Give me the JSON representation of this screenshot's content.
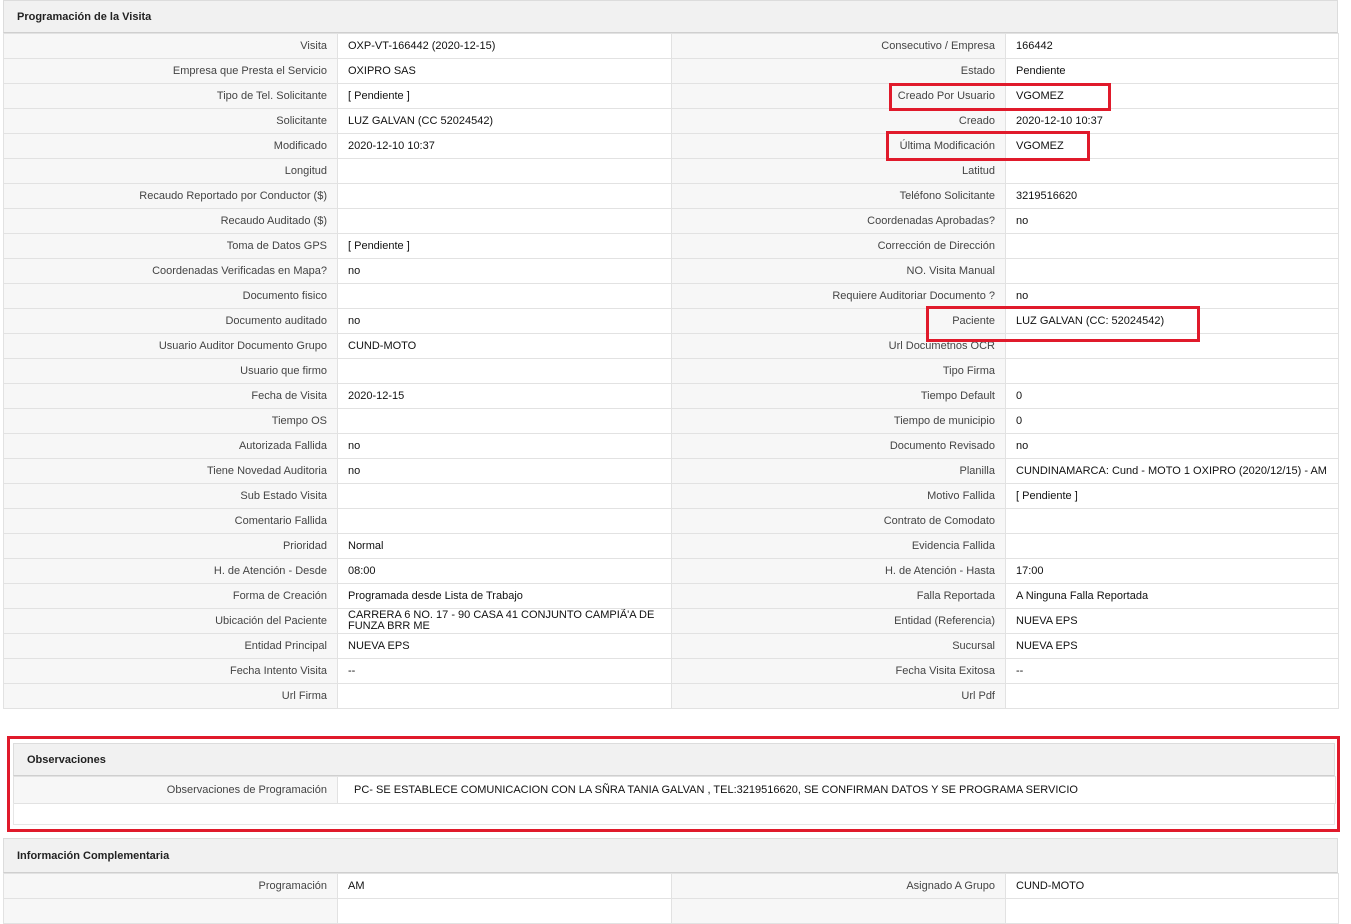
{
  "sections": {
    "programacion_title": "Programación de la Visita",
    "observaciones_title": "Observaciones",
    "complementaria_title": "Información Complementaria"
  },
  "programacion_rows": [
    [
      {
        "label": "Visita",
        "value": "OXP-VT-166442 (2020-12-15)"
      },
      {
        "label": "Consecutivo / Empresa",
        "value": "166442"
      }
    ],
    [
      {
        "label": "Empresa que Presta el Servicio",
        "value": "OXIPRO SAS"
      },
      {
        "label": "Estado",
        "value": "Pendiente"
      }
    ],
    [
      {
        "label": "Tipo de Tel. Solicitante",
        "value": "[ Pendiente ]"
      },
      {
        "label": "Creado Por Usuario",
        "value": "VGOMEZ"
      }
    ],
    [
      {
        "label": "Solicitante",
        "value": "LUZ GALVAN (CC 52024542)"
      },
      {
        "label": "Creado",
        "value": "2020-12-10 10:37"
      }
    ],
    [
      {
        "label": "Modificado",
        "value": "2020-12-10 10:37"
      },
      {
        "label": "Última Modificación",
        "value": "VGOMEZ"
      }
    ],
    [
      {
        "label": "Longitud",
        "value": ""
      },
      {
        "label": "Latitud",
        "value": ""
      }
    ],
    [
      {
        "label": "Recaudo Reportado por Conductor ($)",
        "value": ""
      },
      {
        "label": "Teléfono Solicitante",
        "value": "3219516620"
      }
    ],
    [
      {
        "label": "Recaudo Auditado ($)",
        "value": ""
      },
      {
        "label": "Coordenadas Aprobadas?",
        "value": "no"
      }
    ],
    [
      {
        "label": "Toma de Datos GPS",
        "value": "[ Pendiente ]"
      },
      {
        "label": "Corrección de Dirección",
        "value": ""
      }
    ],
    [
      {
        "label": "Coordenadas Verificadas en Mapa?",
        "value": "no"
      },
      {
        "label": "NO. Visita Manual",
        "value": ""
      }
    ],
    [
      {
        "label": "Documento fisico",
        "value": ""
      },
      {
        "label": "Requiere Auditoriar Documento ?",
        "value": "no"
      }
    ],
    [
      {
        "label": "Documento auditado",
        "value": "no"
      },
      {
        "label": "Paciente",
        "value": "LUZ GALVAN (CC: 52024542)"
      }
    ],
    [
      {
        "label": "Usuario Auditor Documento Grupo",
        "value": "CUND-MOTO"
      },
      {
        "label": "Url Documetnos OCR",
        "value": ""
      }
    ],
    [
      {
        "label": "Usuario que firmo",
        "value": ""
      },
      {
        "label": "Tipo Firma",
        "value": ""
      }
    ],
    [
      {
        "label": "Fecha de Visita",
        "value": "2020-12-15"
      },
      {
        "label": "Tiempo Default",
        "value": "0"
      }
    ],
    [
      {
        "label": "Tiempo OS",
        "value": ""
      },
      {
        "label": "Tiempo de municipio",
        "value": "0"
      }
    ],
    [
      {
        "label": "Autorizada Fallida",
        "value": "no"
      },
      {
        "label": "Documento Revisado",
        "value": "no"
      }
    ],
    [
      {
        "label": "Tiene Novedad Auditoria",
        "value": "no"
      },
      {
        "label": "Planilla",
        "value": "CUNDINAMARCA: Cund - MOTO 1 OXIPRO (2020/12/15) - AM"
      }
    ],
    [
      {
        "label": "Sub Estado Visita",
        "value": ""
      },
      {
        "label": "Motivo Fallida",
        "value": "[ Pendiente ]"
      }
    ],
    [
      {
        "label": "Comentario Fallida",
        "value": ""
      },
      {
        "label": "Contrato de Comodato",
        "value": ""
      }
    ],
    [
      {
        "label": "Prioridad",
        "value": "Normal"
      },
      {
        "label": "Evidencia Fallida",
        "value": ""
      }
    ],
    [
      {
        "label": "H. de Atención - Desde",
        "value": "08:00"
      },
      {
        "label": "H. de Atención - Hasta",
        "value": "17:00"
      }
    ],
    [
      {
        "label": "Forma de Creación",
        "value": "Programada desde Lista de Trabajo"
      },
      {
        "label": "Falla Reportada",
        "value": "A Ninguna Falla Reportada"
      }
    ],
    [
      {
        "label": "Ubicación del Paciente",
        "value": "CARRERA 6 NO. 17 - 90 CASA 41 CONJUNTO CAMPIÃ'A DE FUNZA BRR ME"
      },
      {
        "label": "Entidad (Referencia)",
        "value": "NUEVA EPS"
      }
    ],
    [
      {
        "label": "Entidad Principal",
        "value": "NUEVA EPS"
      },
      {
        "label": "Sucursal",
        "value": "NUEVA EPS"
      }
    ],
    [
      {
        "label": "Fecha Intento Visita",
        "value": "--"
      },
      {
        "label": "Fecha Visita Exitosa",
        "value": "--"
      }
    ],
    [
      {
        "label": "Url Firma",
        "value": ""
      },
      {
        "label": "Url Pdf",
        "value": ""
      }
    ]
  ],
  "observaciones": {
    "label": "Observaciones de Programación",
    "value": "PC- SE ESTABLECE COMUNICACION CON LA SÑRA TANIA GALVAN , TEL:3219516620, SE CONFIRMAN DATOS Y SE PROGRAMA SERVICIO"
  },
  "complementaria_rows": [
    [
      {
        "label": "Programación",
        "value": "AM"
      },
      {
        "label": "Asignado A Grupo",
        "value": "CUND-MOTO"
      }
    ],
    [
      {
        "label": "",
        "value": ""
      },
      {
        "label": "",
        "value": ""
      }
    ]
  ],
  "colors": {
    "highlight": "#e01a2b",
    "header_bg": "#f1f1f1",
    "label_bg": "#f7f7f7",
    "border": "#e2e2e2"
  }
}
